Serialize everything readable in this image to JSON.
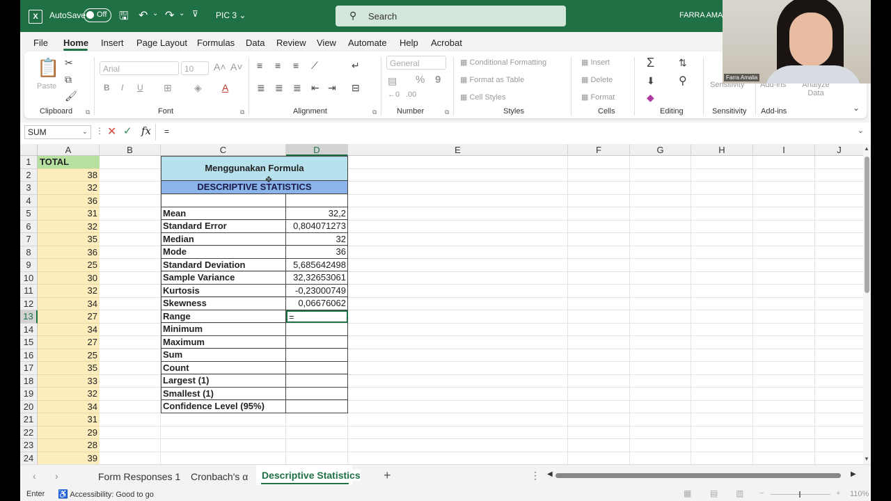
{
  "titlebar": {
    "autosave_label": "AutoSave",
    "autosave_state": "Off",
    "doc_title": "PIC 3",
    "doc_title_caret": "⌄",
    "search_placeholder": "Search",
    "user_name": "FARRA AMALIA"
  },
  "menu": [
    "File",
    "Home",
    "Insert",
    "Page Layout",
    "Formulas",
    "Data",
    "Review",
    "View",
    "Automate",
    "Help",
    "Acrobat"
  ],
  "ribbon": {
    "clipboard": {
      "label": "Clipboard",
      "paste": "Paste"
    },
    "font": {
      "label": "Font",
      "font_name": "Arial",
      "font_size": "10",
      "bold": "B",
      "italic": "I",
      "underline": "U"
    },
    "alignment": {
      "label": "Alignment"
    },
    "number": {
      "label": "Number",
      "format": "General",
      "percent": "%",
      "comma": "9"
    },
    "styles": {
      "label": "Styles",
      "conditional": "Conditional Formatting",
      "format_table": "Format as Table",
      "cell_styles": "Cell Styles"
    },
    "cells": {
      "label": "Cells",
      "insert": "Insert",
      "delete": "Delete",
      "format": "Format"
    },
    "editing": {
      "label": "Editing"
    },
    "sensitivity": {
      "label": "Sensitivity",
      "button": "Sensitivity"
    },
    "addins": {
      "label": "Add-ins",
      "button": "Add-ins",
      "analyze": "Analyze Data"
    }
  },
  "formula_bar": {
    "name_box": "SUM",
    "content": "="
  },
  "grid": {
    "columns": [
      "A",
      "B",
      "C",
      "D",
      "E",
      "F",
      "G",
      "H",
      "I",
      "J"
    ],
    "rows": [
      "1",
      "2",
      "3",
      "4",
      "5",
      "6",
      "7",
      "8",
      "9",
      "10",
      "11",
      "12",
      "13",
      "14",
      "15",
      "16",
      "17",
      "18",
      "19",
      "20",
      "21",
      "22",
      "23",
      "24"
    ],
    "col_a_header": "TOTAL",
    "col_a_values": [
      "38",
      "32",
      "36",
      "31",
      "32",
      "35",
      "36",
      "25",
      "30",
      "32",
      "34",
      "27",
      "34",
      "27",
      "25",
      "35",
      "33",
      "32",
      "34",
      "31",
      "29",
      "28",
      "39"
    ],
    "stats_title": "Menggunakan Formula",
    "stats_subtitle": "DESCRIPTIVE STATISTICS",
    "stats": [
      {
        "label": "",
        "value": ""
      },
      {
        "label": "Mean",
        "value": "32,2"
      },
      {
        "label": "Standard Error",
        "value": "0,804071273"
      },
      {
        "label": "Median",
        "value": "32"
      },
      {
        "label": "Mode",
        "value": "36"
      },
      {
        "label": "Standard Deviation",
        "value": "5,685642498"
      },
      {
        "label": "Sample Variance",
        "value": "32,32653061"
      },
      {
        "label": "Kurtosis",
        "value": "-0,23000749"
      },
      {
        "label": "Skewness",
        "value": "0,06676062"
      },
      {
        "label": "Range",
        "value": "="
      },
      {
        "label": "Minimum",
        "value": ""
      },
      {
        "label": "Maximum",
        "value": ""
      },
      {
        "label": "Sum",
        "value": ""
      },
      {
        "label": "Count",
        "value": ""
      },
      {
        "label": "Largest (1)",
        "value": ""
      },
      {
        "label": "Smallest (1)",
        "value": ""
      },
      {
        "label": "Confidence Level (95%)",
        "value": ""
      }
    ]
  },
  "sheets": [
    "Form Responses 1",
    "Cronbach's α",
    "Descriptive Statistics"
  ],
  "status": {
    "mode": "Enter",
    "accessibility": "Accessibility: Good to go",
    "zoom": "110%"
  },
  "webcam": {
    "name": "Farra Amalia"
  },
  "colors": {
    "accent": "#1f7145",
    "col_a_fill": "#fdedbc",
    "header_fill": "#b7e1a1",
    "title_fill": "#b7e1ec",
    "subtitle_fill": "#8ab4ea"
  }
}
